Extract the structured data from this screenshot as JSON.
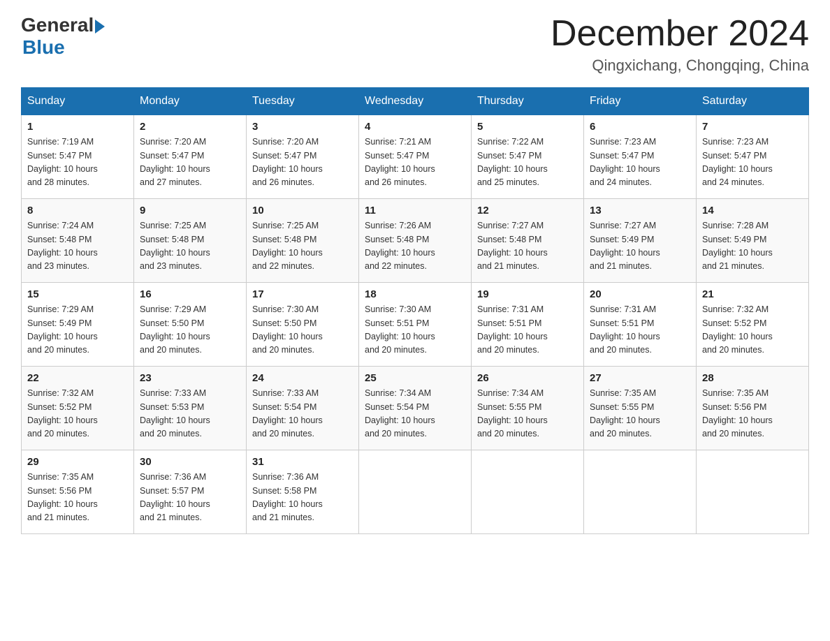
{
  "header": {
    "logo_general": "General",
    "logo_blue": "Blue",
    "month": "December 2024",
    "location": "Qingxichang, Chongqing, China"
  },
  "days_of_week": [
    "Sunday",
    "Monday",
    "Tuesday",
    "Wednesday",
    "Thursday",
    "Friday",
    "Saturday"
  ],
  "weeks": [
    [
      {
        "day": "1",
        "sunrise": "7:19 AM",
        "sunset": "5:47 PM",
        "daylight": "10 hours and 28 minutes."
      },
      {
        "day": "2",
        "sunrise": "7:20 AM",
        "sunset": "5:47 PM",
        "daylight": "10 hours and 27 minutes."
      },
      {
        "day": "3",
        "sunrise": "7:20 AM",
        "sunset": "5:47 PM",
        "daylight": "10 hours and 26 minutes."
      },
      {
        "day": "4",
        "sunrise": "7:21 AM",
        "sunset": "5:47 PM",
        "daylight": "10 hours and 26 minutes."
      },
      {
        "day": "5",
        "sunrise": "7:22 AM",
        "sunset": "5:47 PM",
        "daylight": "10 hours and 25 minutes."
      },
      {
        "day": "6",
        "sunrise": "7:23 AM",
        "sunset": "5:47 PM",
        "daylight": "10 hours and 24 minutes."
      },
      {
        "day": "7",
        "sunrise": "7:23 AM",
        "sunset": "5:47 PM",
        "daylight": "10 hours and 24 minutes."
      }
    ],
    [
      {
        "day": "8",
        "sunrise": "7:24 AM",
        "sunset": "5:48 PM",
        "daylight": "10 hours and 23 minutes."
      },
      {
        "day": "9",
        "sunrise": "7:25 AM",
        "sunset": "5:48 PM",
        "daylight": "10 hours and 23 minutes."
      },
      {
        "day": "10",
        "sunrise": "7:25 AM",
        "sunset": "5:48 PM",
        "daylight": "10 hours and 22 minutes."
      },
      {
        "day": "11",
        "sunrise": "7:26 AM",
        "sunset": "5:48 PM",
        "daylight": "10 hours and 22 minutes."
      },
      {
        "day": "12",
        "sunrise": "7:27 AM",
        "sunset": "5:48 PM",
        "daylight": "10 hours and 21 minutes."
      },
      {
        "day": "13",
        "sunrise": "7:27 AM",
        "sunset": "5:49 PM",
        "daylight": "10 hours and 21 minutes."
      },
      {
        "day": "14",
        "sunrise": "7:28 AM",
        "sunset": "5:49 PM",
        "daylight": "10 hours and 21 minutes."
      }
    ],
    [
      {
        "day": "15",
        "sunrise": "7:29 AM",
        "sunset": "5:49 PM",
        "daylight": "10 hours and 20 minutes."
      },
      {
        "day": "16",
        "sunrise": "7:29 AM",
        "sunset": "5:50 PM",
        "daylight": "10 hours and 20 minutes."
      },
      {
        "day": "17",
        "sunrise": "7:30 AM",
        "sunset": "5:50 PM",
        "daylight": "10 hours and 20 minutes."
      },
      {
        "day": "18",
        "sunrise": "7:30 AM",
        "sunset": "5:51 PM",
        "daylight": "10 hours and 20 minutes."
      },
      {
        "day": "19",
        "sunrise": "7:31 AM",
        "sunset": "5:51 PM",
        "daylight": "10 hours and 20 minutes."
      },
      {
        "day": "20",
        "sunrise": "7:31 AM",
        "sunset": "5:51 PM",
        "daylight": "10 hours and 20 minutes."
      },
      {
        "day": "21",
        "sunrise": "7:32 AM",
        "sunset": "5:52 PM",
        "daylight": "10 hours and 20 minutes."
      }
    ],
    [
      {
        "day": "22",
        "sunrise": "7:32 AM",
        "sunset": "5:52 PM",
        "daylight": "10 hours and 20 minutes."
      },
      {
        "day": "23",
        "sunrise": "7:33 AM",
        "sunset": "5:53 PM",
        "daylight": "10 hours and 20 minutes."
      },
      {
        "day": "24",
        "sunrise": "7:33 AM",
        "sunset": "5:54 PM",
        "daylight": "10 hours and 20 minutes."
      },
      {
        "day": "25",
        "sunrise": "7:34 AM",
        "sunset": "5:54 PM",
        "daylight": "10 hours and 20 minutes."
      },
      {
        "day": "26",
        "sunrise": "7:34 AM",
        "sunset": "5:55 PM",
        "daylight": "10 hours and 20 minutes."
      },
      {
        "day": "27",
        "sunrise": "7:35 AM",
        "sunset": "5:55 PM",
        "daylight": "10 hours and 20 minutes."
      },
      {
        "day": "28",
        "sunrise": "7:35 AM",
        "sunset": "5:56 PM",
        "daylight": "10 hours and 20 minutes."
      }
    ],
    [
      {
        "day": "29",
        "sunrise": "7:35 AM",
        "sunset": "5:56 PM",
        "daylight": "10 hours and 21 minutes."
      },
      {
        "day": "30",
        "sunrise": "7:36 AM",
        "sunset": "5:57 PM",
        "daylight": "10 hours and 21 minutes."
      },
      {
        "day": "31",
        "sunrise": "7:36 AM",
        "sunset": "5:58 PM",
        "daylight": "10 hours and 21 minutes."
      },
      null,
      null,
      null,
      null
    ]
  ],
  "labels": {
    "sunrise": "Sunrise:",
    "sunset": "Sunset:",
    "daylight": "Daylight:"
  }
}
